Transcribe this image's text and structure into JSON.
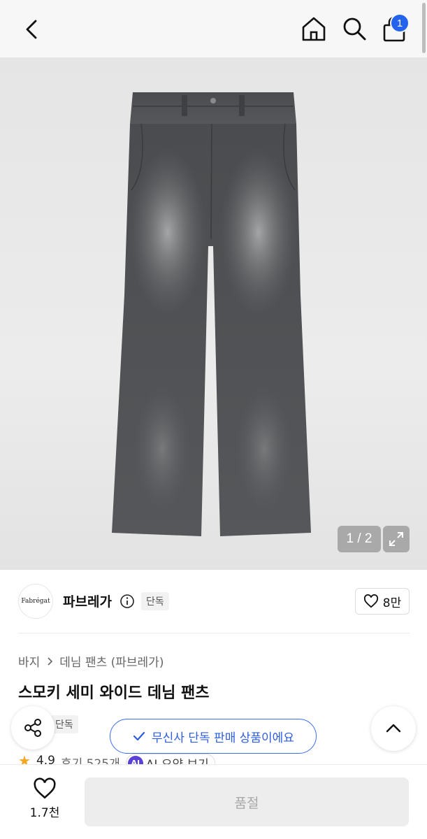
{
  "header": {
    "back_icon": "chevron-left-icon",
    "home_icon": "home-icon",
    "search_icon": "search-icon",
    "cart_icon": "shopping-bag-icon",
    "cart_count": "1",
    "badge_color": "#2463eb"
  },
  "gallery": {
    "counter": "1 / 2",
    "expand_icon": "expand-icon"
  },
  "brand": {
    "logo_text": "Fabrégat",
    "name": "파브레가",
    "info_icon": "info-icon",
    "tag": "단독",
    "likes": "8만"
  },
  "product": {
    "breadcrumb": [
      "바지",
      "데님 팬츠 (파브레가)"
    ],
    "title": "스모키 세미 와이드 데님 팬츠",
    "tag": "단독",
    "exclusive_notice": "무신사 단독 판매 상품이에요",
    "rating": "4.9",
    "reviews": "후기 525개",
    "ai_badge": "AI",
    "ai_summary": "AI 요약 보기",
    "accent_color": "#2d5de0"
  },
  "bottom_bar": {
    "wish_count": "1.7천",
    "purchase_label": "품절"
  }
}
